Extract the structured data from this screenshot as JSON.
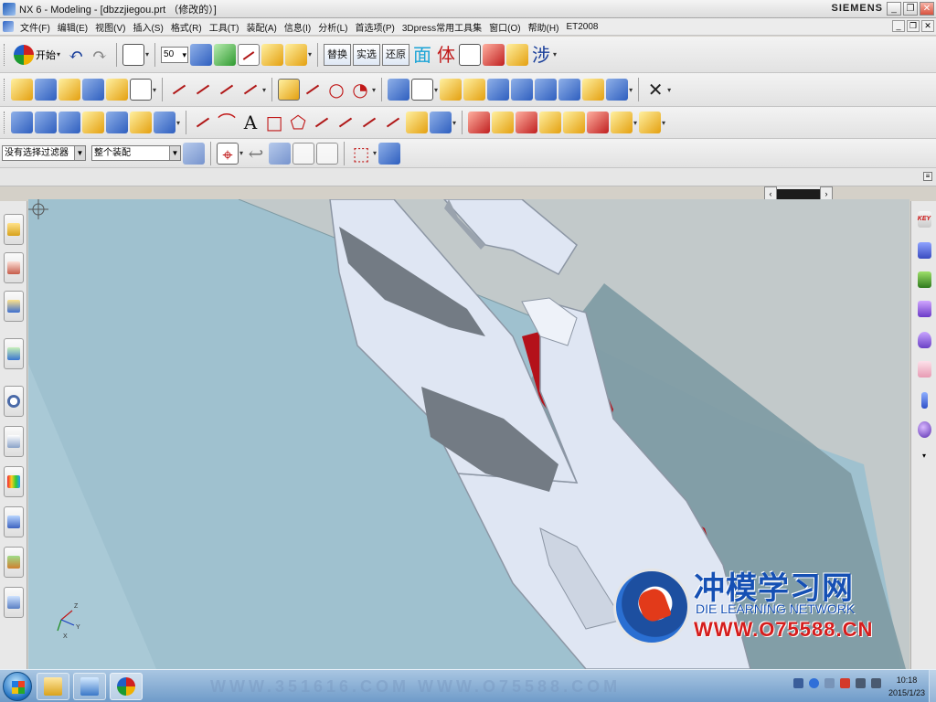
{
  "window": {
    "title": "NX 6 - Modeling - [dbzzjiegou.prt （修改的）]",
    "brand": "SIEMENS",
    "controls": [
      "_",
      "❐",
      "✕"
    ]
  },
  "menubar": {
    "items": [
      "文件(F)",
      "编辑(E)",
      "视图(V)",
      "插入(S)",
      "格式(R)",
      "工具(T)",
      "装配(A)",
      "信息(I)",
      "分析(L)",
      "首选项(P)",
      "3Dpress常用工具集",
      "窗口(O)",
      "帮助(H)",
      "ET2008"
    ],
    "controls": [
      "_",
      "❐",
      "✕"
    ]
  },
  "toolbar1": {
    "start_label": "开始",
    "zoom_value": "50",
    "btn_replace": "替换",
    "btn_real": "实选",
    "btn_restore": "还原",
    "glyph_face": "面",
    "glyph_body": "体",
    "glyph_step": "涉"
  },
  "toolbar3": {
    "text_glyph": "A"
  },
  "selection_bar": {
    "filter_value": "没有选择过滤器",
    "scope_value": "整个装配"
  },
  "right_palette": {
    "key_label": "KEY"
  },
  "watermark": {
    "title": "冲模学习网",
    "subtitle": "DIE LEARNING NETWORK",
    "url": "WWW.O75588.CN"
  },
  "taskbar": {
    "faint_text": "WWW.351616.COM   WWW.O75588.COM",
    "time": "10:18",
    "date": "2015/1/23"
  },
  "axis": {
    "x": "X",
    "y": "Y",
    "z": "Z"
  },
  "colors": {
    "part_face": "#dfe6f3",
    "part_shadow": "#8c96a4",
    "red_face": "#b4111a",
    "plane_light": "#9fc1cf",
    "plane_dark": "#7f9ba4",
    "background": "#c2c9ca",
    "watermark_blue": "#1550b4",
    "watermark_red": "#d51d1d"
  }
}
